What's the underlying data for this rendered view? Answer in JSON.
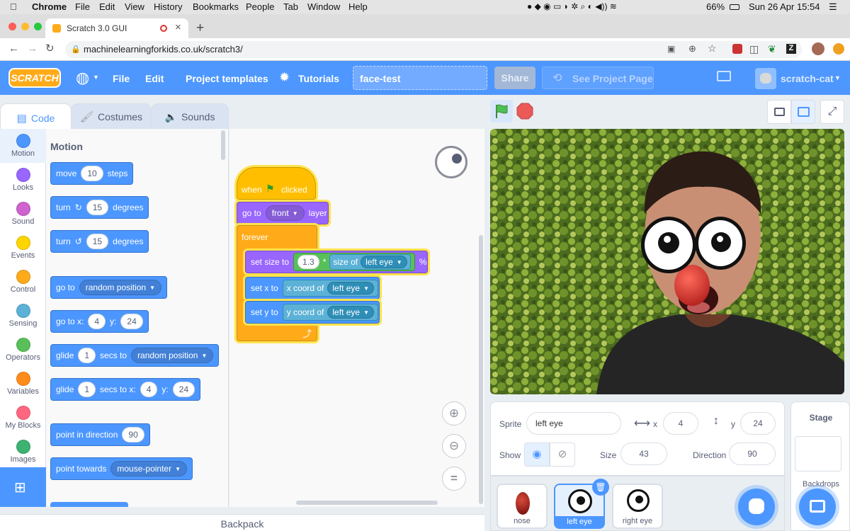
{
  "mac_menu": {
    "items": [
      "Chrome",
      "File",
      "Edit",
      "View",
      "History",
      "Bookmarks",
      "People",
      "Tab",
      "Window",
      "Help"
    ],
    "battery": "66%",
    "datetime": "Sun 26 Apr  15:54"
  },
  "browser": {
    "tab_title": "Scratch 3.0 GUI",
    "url": "machinelearningforkids.co.uk/scratch3/"
  },
  "scratch_menu": {
    "logo": "SCRATCH",
    "file": "File",
    "edit": "Edit",
    "templates": "Project templates",
    "tutorials": "Tutorials",
    "project_title": "face-test",
    "share": "Share",
    "see_project": "See Project Page",
    "user": "scratch-cat"
  },
  "tabs": {
    "code": "Code",
    "costumes": "Costumes",
    "sounds": "Sounds"
  },
  "categories": [
    {
      "label": "Motion",
      "color": "#4c97ff"
    },
    {
      "label": "Looks",
      "color": "#9966ff"
    },
    {
      "label": "Sound",
      "color": "#cf63cf"
    },
    {
      "label": "Events",
      "color": "#ffd500"
    },
    {
      "label": "Control",
      "color": "#ffab19"
    },
    {
      "label": "Sensing",
      "color": "#5cb1d6"
    },
    {
      "label": "Operators",
      "color": "#59c059"
    },
    {
      "label": "Variables",
      "color": "#ff8c1a"
    },
    {
      "label": "My Blocks",
      "color": "#ff6680"
    },
    {
      "label": "Images",
      "color": "#3cb371"
    }
  ],
  "palette": {
    "heading": "Motion",
    "move": {
      "a": "move",
      "v": "10",
      "b": "steps"
    },
    "turn_right": {
      "a": "turn",
      "v": "15",
      "b": "degrees"
    },
    "turn_left": {
      "a": "turn",
      "v": "15",
      "b": "degrees"
    },
    "goto": {
      "a": "go to",
      "d": "random position"
    },
    "gotoxy": {
      "a": "go to x:",
      "x": "4",
      "b": "y:",
      "y": "24"
    },
    "glide": {
      "a": "glide",
      "v": "1",
      "b": "secs to",
      "d": "random position"
    },
    "glidexy": {
      "a": "glide",
      "v": "1",
      "b": "secs to x:",
      "x": "4",
      "c": "y:",
      "y": "24"
    },
    "point": {
      "a": "point in direction",
      "v": "90"
    },
    "towards": {
      "a": "point towards",
      "d": "mouse-pointer"
    }
  },
  "script": {
    "hat": {
      "a": "when",
      "b": "clicked"
    },
    "goto_layer": {
      "a": "go to",
      "d": "front",
      "b": "layer"
    },
    "forever": "forever",
    "setsize": {
      "a": "set size to",
      "v": "1.3",
      "op": "*",
      "b": "size of",
      "d": "left eye",
      "pct": "%"
    },
    "setx": {
      "a": "set x to",
      "b": "x coord of",
      "d": "left eye"
    },
    "sety": {
      "a": "set y to",
      "b": "y coord of",
      "d": "left eye"
    }
  },
  "backpack": "Backpack",
  "sprite_info": {
    "sprite_label": "Sprite",
    "sprite_name": "left eye",
    "x_label": "x",
    "x": "4",
    "y_label": "y",
    "y": "24",
    "show_label": "Show",
    "size_label": "Size",
    "size": "43",
    "direction_label": "Direction",
    "direction": "90"
  },
  "sprites": [
    "nose",
    "left eye",
    "right eye"
  ],
  "stage_panel": {
    "title": "Stage",
    "backdrops": "Backdrops"
  }
}
